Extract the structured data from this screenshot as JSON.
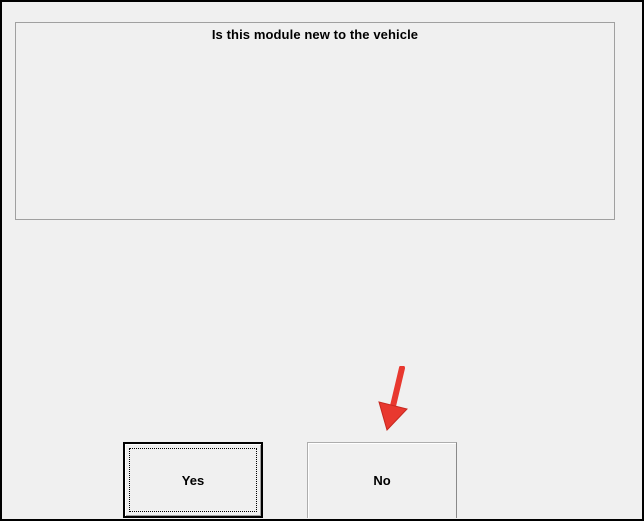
{
  "dialog": {
    "message": "Is this module new to the vehicle",
    "buttons": {
      "yes_label": "Yes",
      "no_label": "No"
    }
  },
  "annotation": {
    "arrow_color": "#e8382f",
    "arrow_target": "no-button"
  },
  "colors": {
    "window_bg": "#f0f0f0",
    "frame": "#000000",
    "panel_border": "#a0a0a0"
  }
}
